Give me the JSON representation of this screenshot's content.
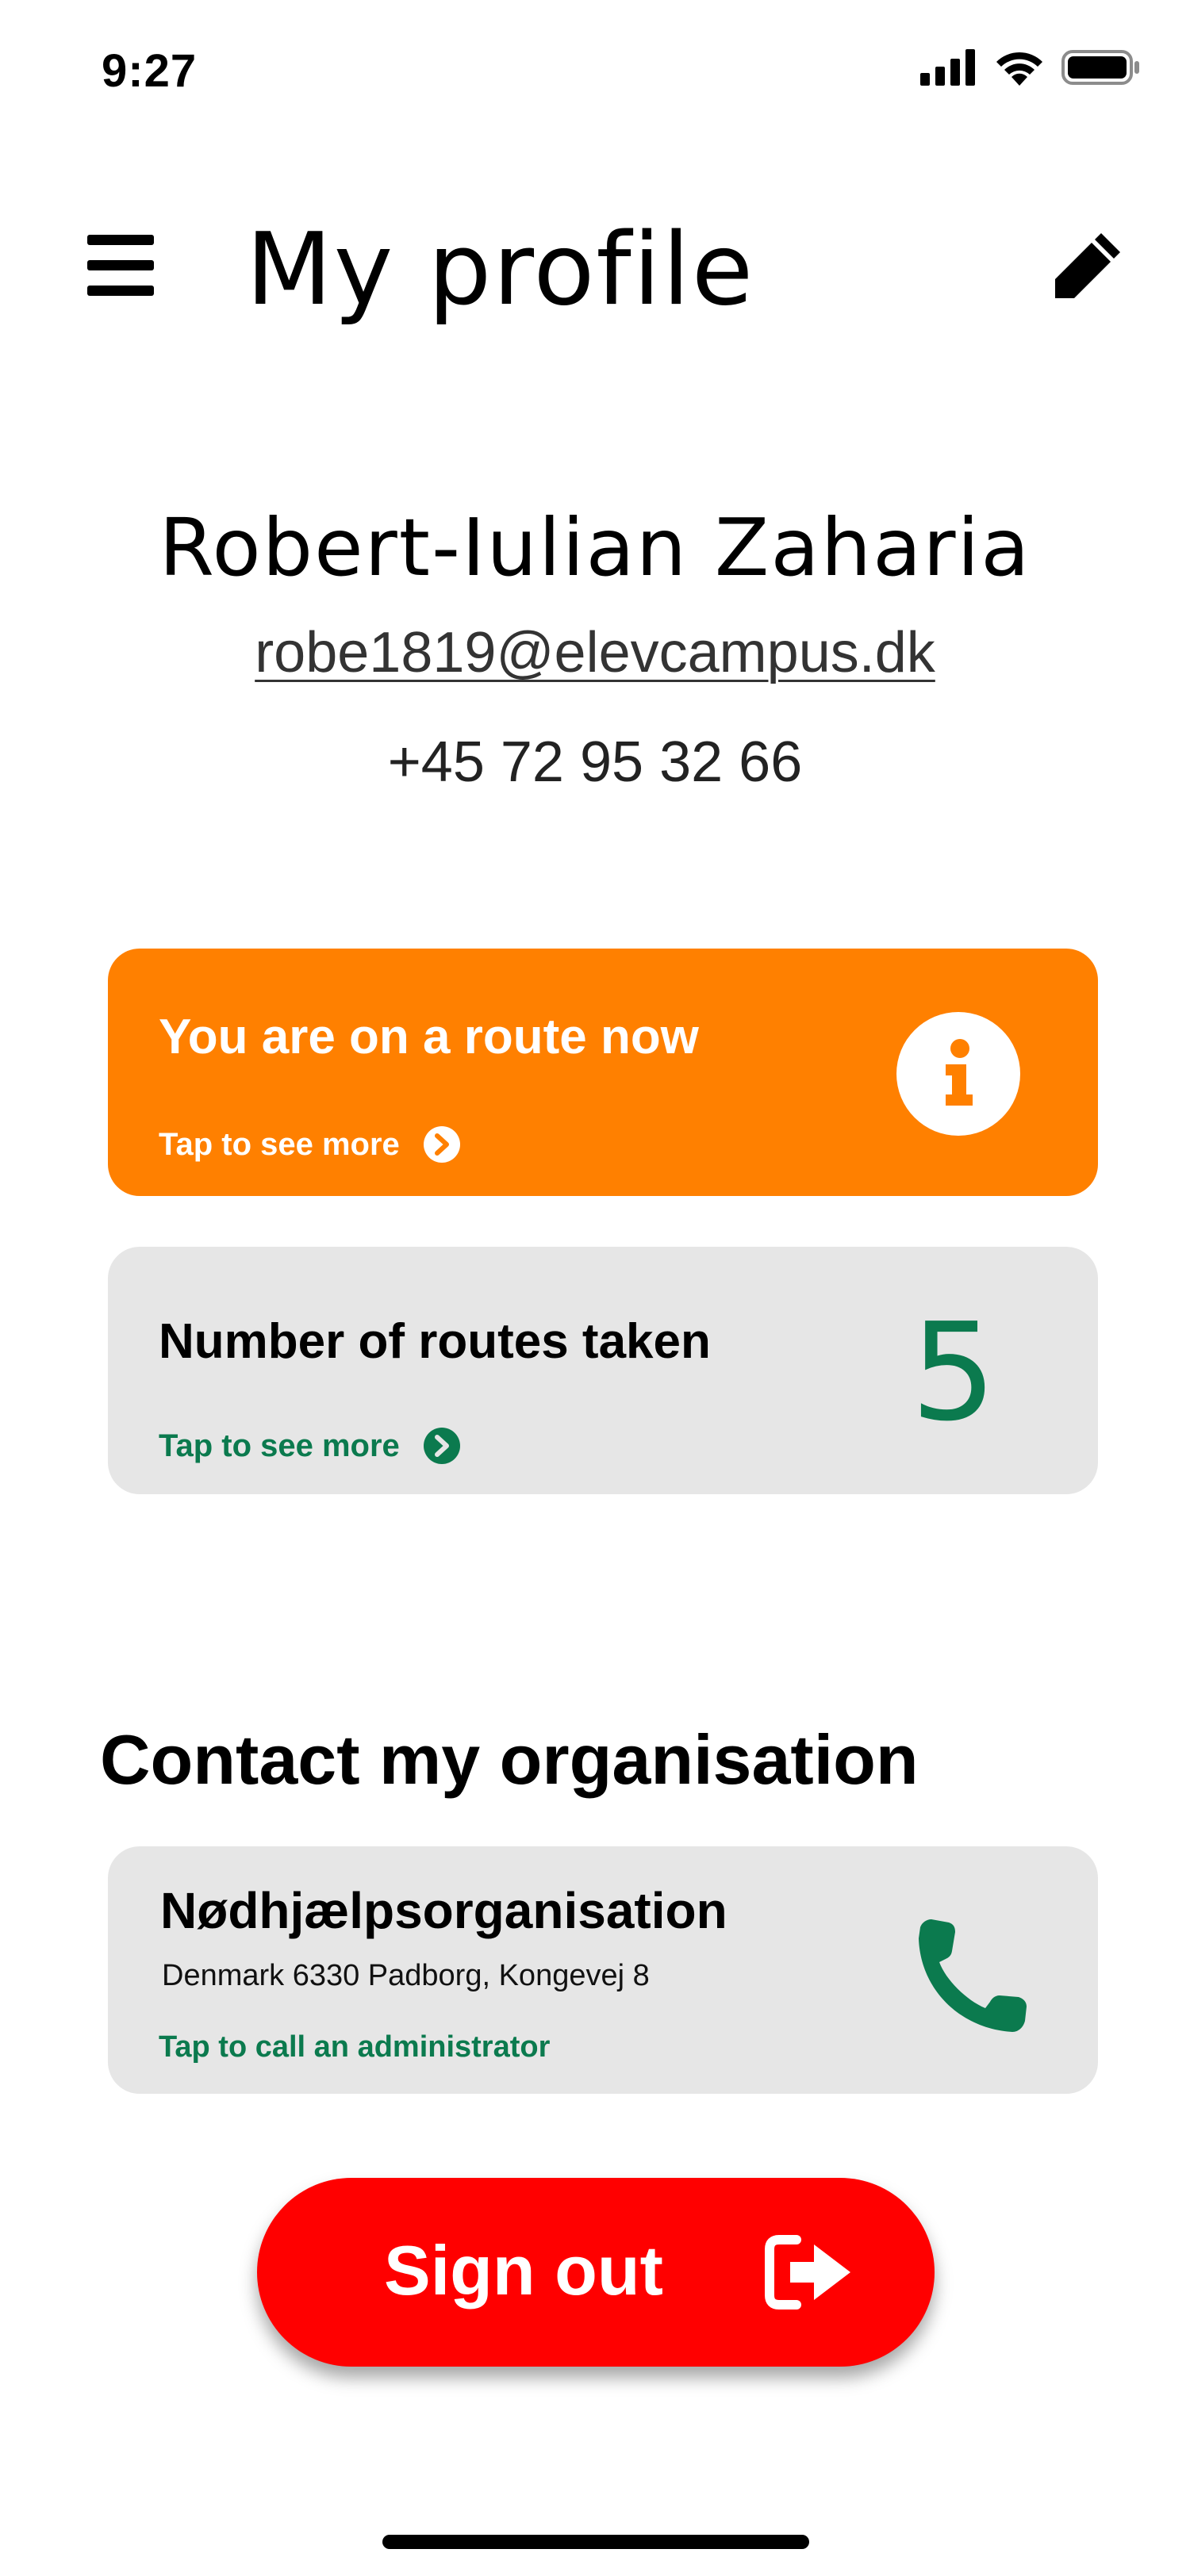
{
  "status_bar": {
    "time": "9:27"
  },
  "header": {
    "title": "My profile"
  },
  "profile": {
    "name": "Robert-Iulian Zaharia",
    "email": "robe1819@elevcampus.dk",
    "phone": "+45 72 95 32 66"
  },
  "route_card": {
    "title": "You are on a route now",
    "link": "Tap to see more"
  },
  "routes_taken_card": {
    "title": "Number of routes taken",
    "count": "5",
    "link": "Tap to see more"
  },
  "contact": {
    "section_title": "Contact my organisation",
    "org_name": "Nødhjælpsorganisation",
    "address": "Denmark 6330 Padborg, Kongevej 8",
    "link": "Tap to call an administrator"
  },
  "signout": {
    "label": "Sign out"
  },
  "colors": {
    "orange": "#ff8000",
    "green": "#0b7a4e",
    "red": "#ff0000",
    "card_grey": "#e6e6e6"
  },
  "icons": [
    "hamburger-menu-icon",
    "pencil-edit-icon",
    "info-icon",
    "chevron-right-circle-icon",
    "phone-icon",
    "sign-out-icon",
    "signal-icon",
    "wifi-icon",
    "battery-icon"
  ]
}
